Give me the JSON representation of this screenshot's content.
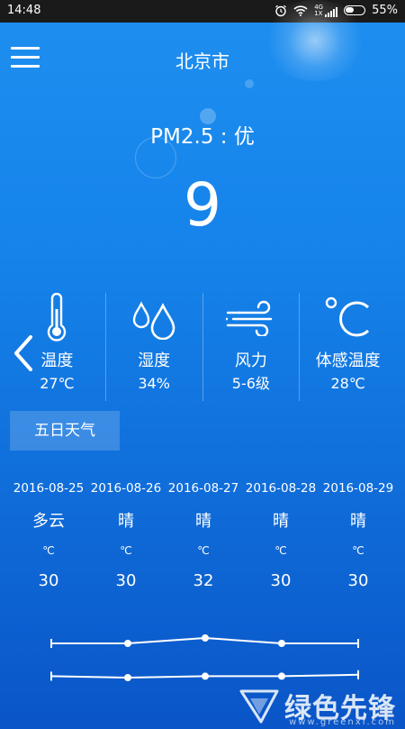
{
  "status_bar": {
    "time": "14:48",
    "network": "4G",
    "network_sub": "1X",
    "battery": "55%"
  },
  "header": {
    "city": "北京市"
  },
  "pm25": {
    "label": "PM2.5 : 优",
    "value": "9"
  },
  "metrics": [
    {
      "icon": "thermometer-icon",
      "label": "温度",
      "value": "27℃"
    },
    {
      "icon": "humidity-drops-icon",
      "label": "湿度",
      "value": "34%"
    },
    {
      "icon": "wind-icon",
      "label": "风力",
      "value": "5-6级"
    },
    {
      "icon": "celsius-icon",
      "label": "体感温度",
      "value": "28℃"
    }
  ],
  "five_day_tab": "五日天气",
  "forecast": [
    {
      "date": "2016-08-25",
      "condition": "多云",
      "unit": "℃",
      "temp": "30"
    },
    {
      "date": "2016-08-26",
      "condition": "晴",
      "unit": "℃",
      "temp": "30"
    },
    {
      "date": "2016-08-27",
      "condition": "晴",
      "unit": "℃",
      "temp": "32"
    },
    {
      "date": "2016-08-28",
      "condition": "晴",
      "unit": "℃",
      "temp": "30"
    },
    {
      "date": "2016-08-29",
      "condition": "晴",
      "unit": "℃",
      "temp": "30"
    }
  ],
  "trend_lines": {
    "high": [
      30,
      30,
      32,
      30,
      30
    ],
    "low": [
      20,
      19,
      20,
      20,
      21
    ]
  },
  "watermark": {
    "brand": "绿色先锋",
    "url": "www.greenxf.com"
  },
  "colors": {
    "background_top": "#1e8ff0",
    "background_bottom": "#0a55c8",
    "text": "#ffffff"
  }
}
